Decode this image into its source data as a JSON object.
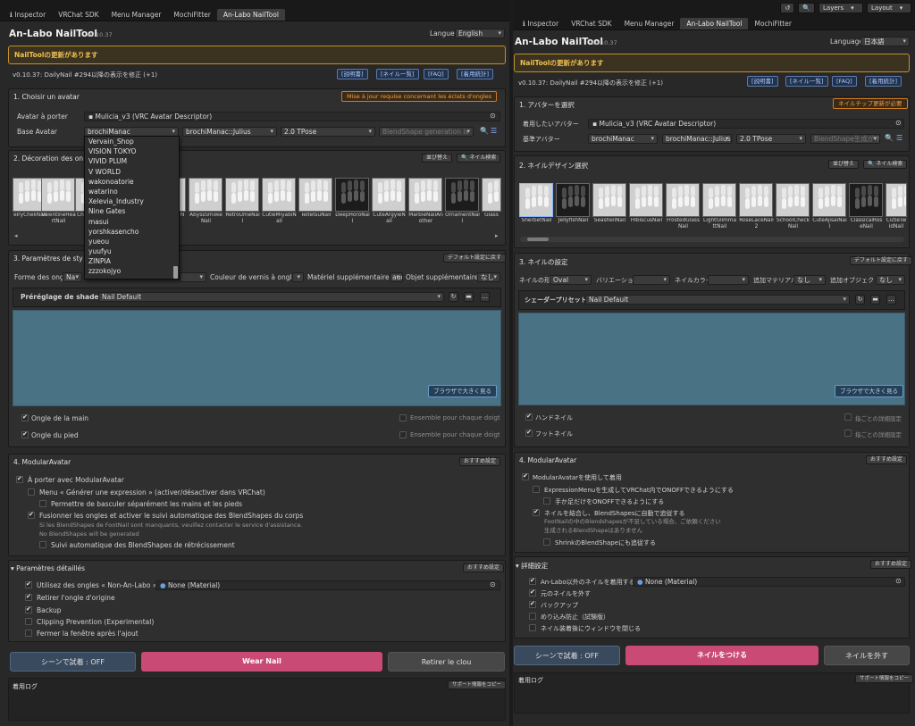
{
  "left": {
    "tabs": [
      "Inspector",
      "VRChat SDK",
      "Menu Manager",
      "MochiFitter",
      "An-Labo NailTool"
    ],
    "title": "An-Labo NailTool",
    "version": "v0.10.37",
    "language_label": "Langue",
    "language_value": "English",
    "banner": "NailToolの更新があります",
    "version_line": "v0.10.37: DailyNail #294以降の表示を修正 (+1)",
    "links": [
      "[説明書]",
      "[ネイル一覧]",
      "[FAQ]",
      "[着用統計]"
    ],
    "s1": {
      "heading": "1.  Choisir un avatar",
      "update_btn": "Mise à jour requise concernant les éclats d'ongles",
      "avatar_label": "Avatar à porter",
      "avatar_value": "Mulicia_v3 (VRC Avatar Descriptor)",
      "base_label": "Base Avatar",
      "base_sel1": "brochiManac",
      "base_sel2": "brochiManac::Julius",
      "base_sel3": "2.0 TPose",
      "blendshape": "BlendShape generation is"
    },
    "dropdown": [
      "Vervain_Shop",
      "VISION TOKYO",
      "VIVID PLUM",
      "V WORLD",
      "wakonoatorie",
      "watarino",
      "Xelevia_Industry",
      "Nine Gates",
      "masui",
      "yorshkasencho",
      "yueou",
      "yuufyu",
      "ZINPIA",
      "zzzokojyo"
    ],
    "s2": {
      "heading": "2.  Décoration des on",
      "btn_sort": "並び替え",
      "btn_search": "🔍 ネイル検索",
      "thumbs": [
        "elryChekNail",
        "ValentineHeartNail",
        "Ch",
        "N",
        "AbyssSmokeNail",
        "RetroUmeNail",
        "CutieMiyabiNail",
        "TeitetsuNail",
        "DeepHoroNail",
        "CuteArgyleNail",
        "MarbleNailAnother",
        "OrnamentNail",
        "Glass"
      ]
    },
    "s3": {
      "heading": "3.  Paramètres de sty",
      "btn_default": "デフォルト設定に戻す",
      "shape_label": "Forme des ongles",
      "shape_value": "Na",
      "color_label": "Couleur de vernis à ongle",
      "mat_label": "Matériel supplémentaire.",
      "mat_value": "aucun",
      "obj_label": "Objet supplémentaire",
      "obj_value": "なし",
      "shader_label": "Préréglage de shader",
      "shader_value": "Nail Default",
      "preview_btn": "ブラウザで大きく見る",
      "hand": "Ongle de la main",
      "foot": "Ongle du pied",
      "each_finger": "Ensemble pour chaque doigt",
      "each_toe": "Ensemble pour chaque doigt"
    },
    "s4": {
      "heading": "4.  ModularAvatar",
      "btn": "おすすめ設定",
      "c1": "À porter avec ModularAvatar",
      "c2": "Menu « Générer une expression » (activer/désactiver dans VRChat)",
      "c3": "Permettre de basculer séparément les mains et les pieds",
      "c4": "Fusionner les ongles et activer le suivi automatique des BlendShapes du corps",
      "n1": "Si les BlendShapes de FootNail sont manquants, veuillez contacter le service d'assistance.",
      "n2": "No BlendShapes will be generated",
      "c5": "Suivi automatique des BlendShapes de rétrécissement"
    },
    "s5": {
      "heading": "Paramètres détaillés",
      "btn": "おすすめ設定",
      "c1": "Utilisez des ongles « Non-An-Labo »",
      "c1_value": "None (Material)",
      "c2": "Retirer l'ongle d'origine",
      "c3": "Backup",
      "c4": "Clipping Prevention (Experimental)",
      "c5": "Fermer la fenêtre après l'ajout"
    },
    "bottom": {
      "scene": "シーンで試着 : OFF",
      "wear": "Wear Nail",
      "remove": "Retirer le clou"
    },
    "log": {
      "heading": "着用ログ",
      "copy": "サポート情報をコピー"
    }
  },
  "right": {
    "top_buttons": [
      "↺",
      "🔍",
      "Layers",
      "Layout"
    ],
    "tabs": [
      "Inspector",
      "VRChat SDK",
      "Menu Manager",
      "An-Labo NailTool",
      "MochiFitter"
    ],
    "title": "An-Labo NailTool",
    "version": "v0.10.37",
    "language_label": "Language",
    "language_value": "日本語",
    "banner": "NailToolの更新があります",
    "version_line": "v0.10.37: DailyNail #294以降の表示を修正 (+1)",
    "links": [
      "[説明書]",
      "[ネイル一覧]",
      "[FAQ]",
      "[着用統計]"
    ],
    "s1": {
      "heading": "1.  アバターを選択",
      "update_btn": "ネイルチップ更新が必要",
      "avatar_label": "着用したいアバター",
      "avatar_value": "Mulicia_v3 (VRC Avatar Descriptor)",
      "base_label": "基準アバター",
      "base_sel1": "brochiManac",
      "base_sel2": "brochiManac::Julius",
      "base_sel3": "2.0 TPose",
      "blendshape": "BlendShape生成がネ"
    },
    "s2": {
      "heading": "2.  ネイルデザイン選択",
      "btn_sort": "並び替え",
      "btn_search": "🔍 ネイル検索",
      "thumbs": [
        "SherbetNail",
        "JellyfishNail",
        "SeashellNail",
        "HibiscusNail",
        "FrostedGlassNail",
        "LightGlimmattNail",
        "RoseLaceNail2",
        "SchoolCheckNail",
        "CuteAjisaiNail",
        "ClassicalRoseNail",
        "CutieTwidNail"
      ]
    },
    "s3": {
      "heading": "3.  ネイルの設定",
      "btn_default": "デフォルト設定に戻す",
      "shape_label": "ネイルの形",
      "shape_value": "Oval",
      "var_label": "バリエーション",
      "color_label": "ネイルカラー",
      "mat_label": "追加マテリアル",
      "mat_value": "なし",
      "obj_label": "追加オブジェクト",
      "obj_value": "なし",
      "shader_label": "シェーダープリセット",
      "shader_value": "Nail Default",
      "preview_btn": "ブラウザで大きく見る",
      "hand": "ハンドネイル",
      "foot": "フットネイル",
      "each_finger": "指ごとの詳細設定",
      "each_toe": "指ごとの詳細設定"
    },
    "s4": {
      "heading": "4.  ModularAvatar",
      "btn": "おすすめ設定",
      "c1": "ModularAvatarを使用して着用",
      "c2": "ExpressionMenuを生成してVRChat内でONOFFできるようにする",
      "c3": "手か足だけをONOFFできるようにする",
      "c4": "ネイルを結合し、BlendShapesに自動で追従する",
      "n1": "FootNailの中のBlendshapesが不足している場合、ご依頼ください",
      "n2": "生成されるBlendShapeはありません",
      "c5": "ShrinkのBlendShapeにも追従する"
    },
    "s5": {
      "heading": "詳細設定",
      "btn": "おすすめ設定",
      "c1": "An-Labo以外のネイルを着用する",
      "c1_value": "None (Material)",
      "c2": "元のネイルを外す",
      "c3": "バックアップ",
      "c4": "めり込み防止（試験版）",
      "c5": "ネイル装着後にウィンドウを閉じる"
    },
    "bottom": {
      "scene": "シーンで試着 : OFF",
      "wear": "ネイルをつける",
      "remove": "ネイルを外す"
    },
    "log": {
      "heading": "着用ログ",
      "copy": "サポート情報をコピー"
    }
  },
  "colors": {
    "wear": "#c94a75",
    "scene": "#3a4a5e",
    "preview": "#4a7285",
    "banner": "#f1c050"
  }
}
